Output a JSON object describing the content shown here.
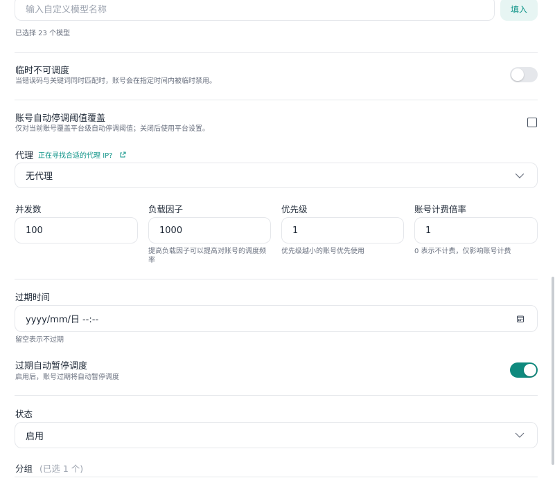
{
  "models": {
    "custom_placeholder": "输入自定义模型名称",
    "fill_button": "填入",
    "selected_count": "已选择 23 个模型"
  },
  "temp_unschedulable": {
    "title": "临时不可调度",
    "description": "当错误码与关键词同时匹配时，账号会在指定时间内被临时禁用。",
    "enabled": false
  },
  "auto_pause_override": {
    "title": "账号自动停调阈值覆盖",
    "description": "仅对当前账号覆盖平台级自动停调阈值；关闭后使用平台设置。",
    "checked": false
  },
  "proxy": {
    "label": "代理",
    "link_text": "正在寻找合适的代理 IP?",
    "value": "无代理"
  },
  "fields": {
    "concurrency": {
      "label": "并发数",
      "value": "100"
    },
    "load_factor": {
      "label": "负载因子",
      "value": "1000",
      "hint": "提高负载因子可以提高对账号的调度频率"
    },
    "priority": {
      "label": "优先级",
      "value": "1",
      "hint": "优先级越小的账号优先使用"
    },
    "billing_rate": {
      "label": "账号计费倍率",
      "value": "1",
      "hint": "0 表示不计费，仅影响账号计费"
    }
  },
  "expiry": {
    "label": "过期时间",
    "value": "yyyy/mm/日 --:--",
    "hint": "留空表示不过期"
  },
  "auto_pause_on_expiry": {
    "title": "过期自动暂停调度",
    "description": "启用后，账号过期将自动暂停调度",
    "enabled": true
  },
  "status": {
    "label": "状态",
    "value": "启用"
  },
  "group": {
    "label": "分组",
    "count": "(已选 1 个)"
  },
  "colors": {
    "accent": "#0f9488",
    "toggle_on": "#0f8a7e",
    "border": "#e5e7eb"
  }
}
